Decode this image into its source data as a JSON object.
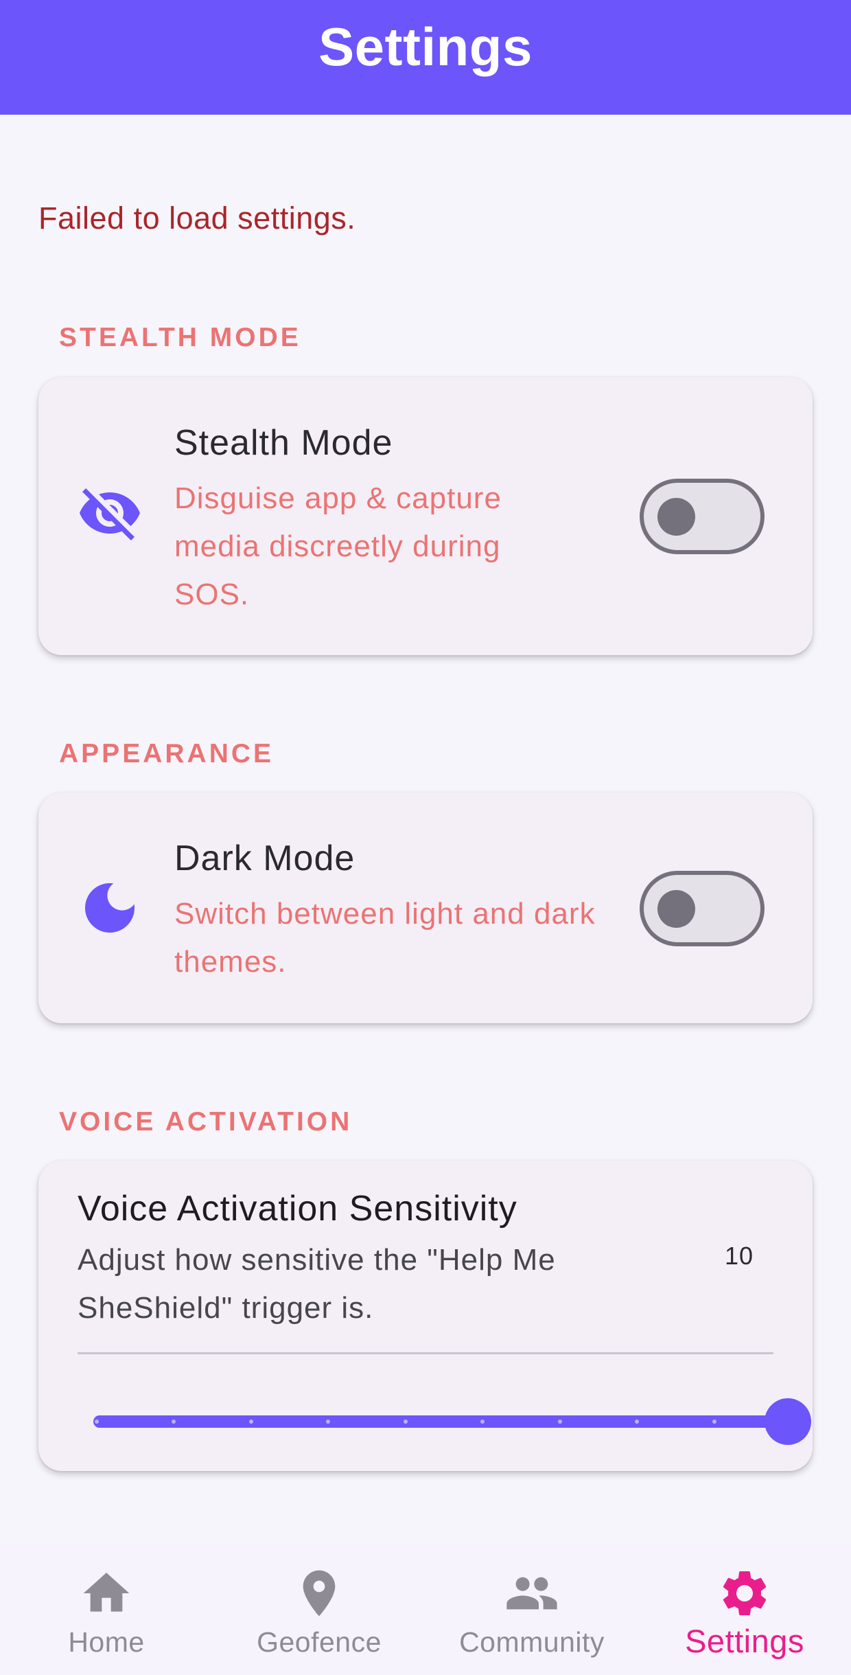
{
  "app_bar": {
    "title": "Settings"
  },
  "error_message": "Failed to load settings.",
  "sections": {
    "stealth": {
      "header": "STEALTH MODE",
      "icon": "eye-off-icon",
      "title": "Stealth Mode",
      "subtitle": "Disguise app & capture media discreetly during SOS.",
      "enabled": false
    },
    "appearance": {
      "header": "APPEARANCE",
      "icon": "moon-icon",
      "title": "Dark Mode",
      "subtitle": "Switch between light and dark themes.",
      "enabled": false
    },
    "voice": {
      "header": "VOICE ACTIVATION",
      "title": "Voice Activation Sensitivity",
      "subtitle": "Adjust how sensitive the \"Help Me SheShield\" trigger is.",
      "value_label": "10",
      "slider": {
        "min": 1,
        "max": 10,
        "value": 10
      }
    }
  },
  "bottom_nav": {
    "items": [
      {
        "label": "Home",
        "icon": "home-icon",
        "active": false
      },
      {
        "label": "Geofence",
        "icon": "location-pin-icon",
        "active": false
      },
      {
        "label": "Community",
        "icon": "people-icon",
        "active": false
      },
      {
        "label": "Settings",
        "icon": "gear-icon",
        "active": true
      }
    ]
  },
  "colors": {
    "primary": "#6C55FA",
    "accent_pink": "#E91E8C",
    "section_header": "#EB7373",
    "error": "#A8262A",
    "inactive_nav": "#8E8B94"
  }
}
